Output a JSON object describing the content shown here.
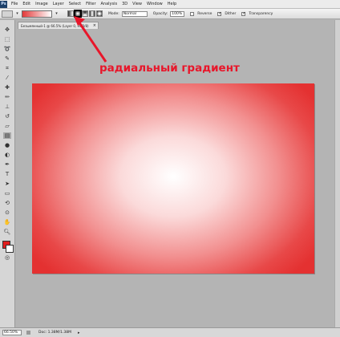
{
  "menubar": {
    "logo": "Ps",
    "items": [
      "File",
      "Edit",
      "Image",
      "Layer",
      "Select",
      "Filter",
      "Analysis",
      "3D",
      "View",
      "Window",
      "Help"
    ]
  },
  "options": {
    "mode_label": "Mode:",
    "mode_value": "Normal",
    "opacity_label": "Opacity:",
    "opacity_value": "100%",
    "reverse_label": "Reverse",
    "dither_label": "Dither",
    "transparency_label": "Transparency",
    "gradient_types": [
      "linear",
      "radial",
      "angle",
      "reflected",
      "diamond"
    ],
    "selected_gradient_type": "radial",
    "gradient_colors": [
      "#e33a3a",
      "#ffffff"
    ]
  },
  "document": {
    "tab_title": "Безымянный-1 @ 66.5% (Layer 0, RGB/8)",
    "close_glyph": "×"
  },
  "annotation": {
    "text": "радиальный градиент",
    "color": "#e8162a"
  },
  "canvas": {
    "center_color": "#ffffff",
    "edge_color": "#e43131"
  },
  "toolbox": {
    "foreground_color": "#e01e1e",
    "background_color": "#ffffff"
  },
  "status": {
    "zoom": "66.50%",
    "doc_size": "Doc: 1.38M/1.38M",
    "arrow": "▸"
  }
}
